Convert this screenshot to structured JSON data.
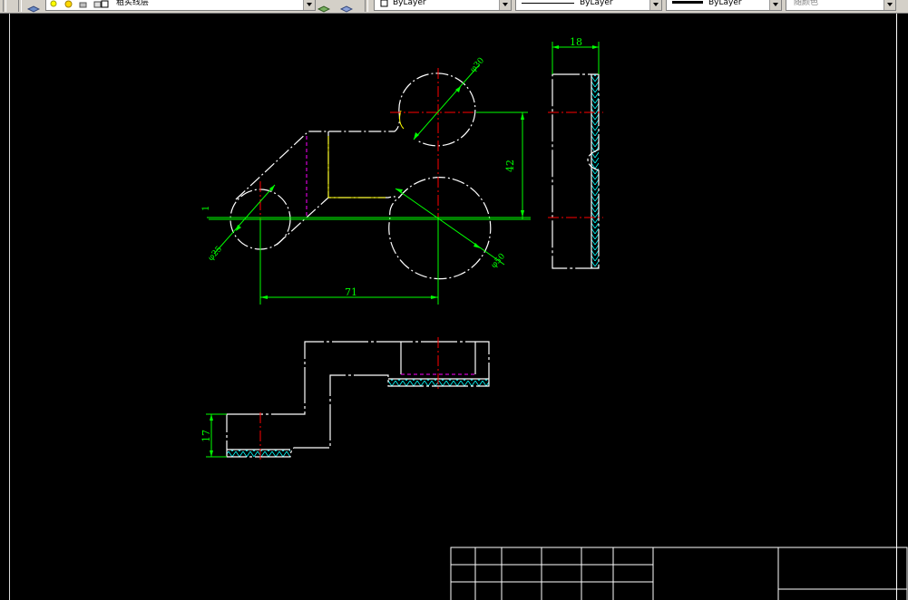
{
  "toolbar": {
    "layer_name": "粗实线层",
    "color_value": "ByLayer",
    "linetype_value": "ByLayer",
    "lineweight_value": "ByLayer",
    "plotstyle_value": "随颜色"
  },
  "drawing": {
    "dims": {
      "top_width": "18",
      "dia_small": "φ25",
      "dia_top": "φ30",
      "dia_big": "φ50",
      "offset_1": "1",
      "center_dist_h": "71",
      "center_dist_v": "42",
      "front_height": "17"
    }
  },
  "colors": {
    "outline": "#ffffff",
    "dim": "#00ff00",
    "center": "#ff0000",
    "hidden": "#ff00ff",
    "hatch": "#00ffff",
    "yellow": "#ffff00"
  }
}
